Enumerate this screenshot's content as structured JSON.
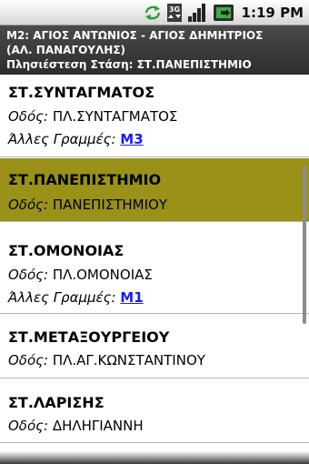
{
  "status_bar": {
    "time": "1:19 PM",
    "icons": [
      "sync-icon",
      "3g-icon",
      "signal-icon",
      "battery-icon"
    ],
    "network_label": "3G"
  },
  "header": {
    "line1": "Μ2: ΑΓΙΟΣ ΑΝΤΩΝΙΟΣ - ΑΓΙΟΣ ΔΗΜΗΤΡΙΟΣ",
    "line2": "(ΑΛ. ΠΑΝΑΓΟΥΛΗΣ)",
    "line3": "Πλησιέστεση Στάση: ΣΤ.ΠΑΝΕΠΙΣΤΗΜΙΟ"
  },
  "labels": {
    "street": "Οδός:",
    "other_lines": "Άλλες Γραμμές:"
  },
  "stops": [
    {
      "name": "ΣΤ.ΣΥΝΤΑΓΜΑΤΟΣ",
      "street": "ΠΛ.ΣΥΝΤΑΓΜΑΤΟΣ",
      "other_lines": "Μ3"
    },
    {
      "name": "ΣΤ.ΠΑΝΕΠΙΣΤΗΜΙΟ",
      "street": "ΠΑΝΕΠΙΣΤΗΜΙΟΥ",
      "selected": true
    },
    {
      "name": "ΣΤ.ΟΜΟΝΟΙΑΣ",
      "street": "ΠΛ.ΟΜΟΝΟΙΑΣ",
      "other_lines": "Μ1"
    },
    {
      "name": "ΣΤ.ΜΕΤΑΞΟΥΡΓΕΙΟΥ",
      "street": "ΠΛ.ΑΓ.ΚΩΝΣΤΑΝΤΙΝΟΥ"
    },
    {
      "name": "ΣΤ.ΛΑΡΙΣΗΣ",
      "street": "ΔΗΛΗΓΙΑΝΝΗ"
    }
  ],
  "colors": {
    "selected_row": "#9a9119",
    "link": "#1a1aff",
    "header_bg": "#333333"
  }
}
